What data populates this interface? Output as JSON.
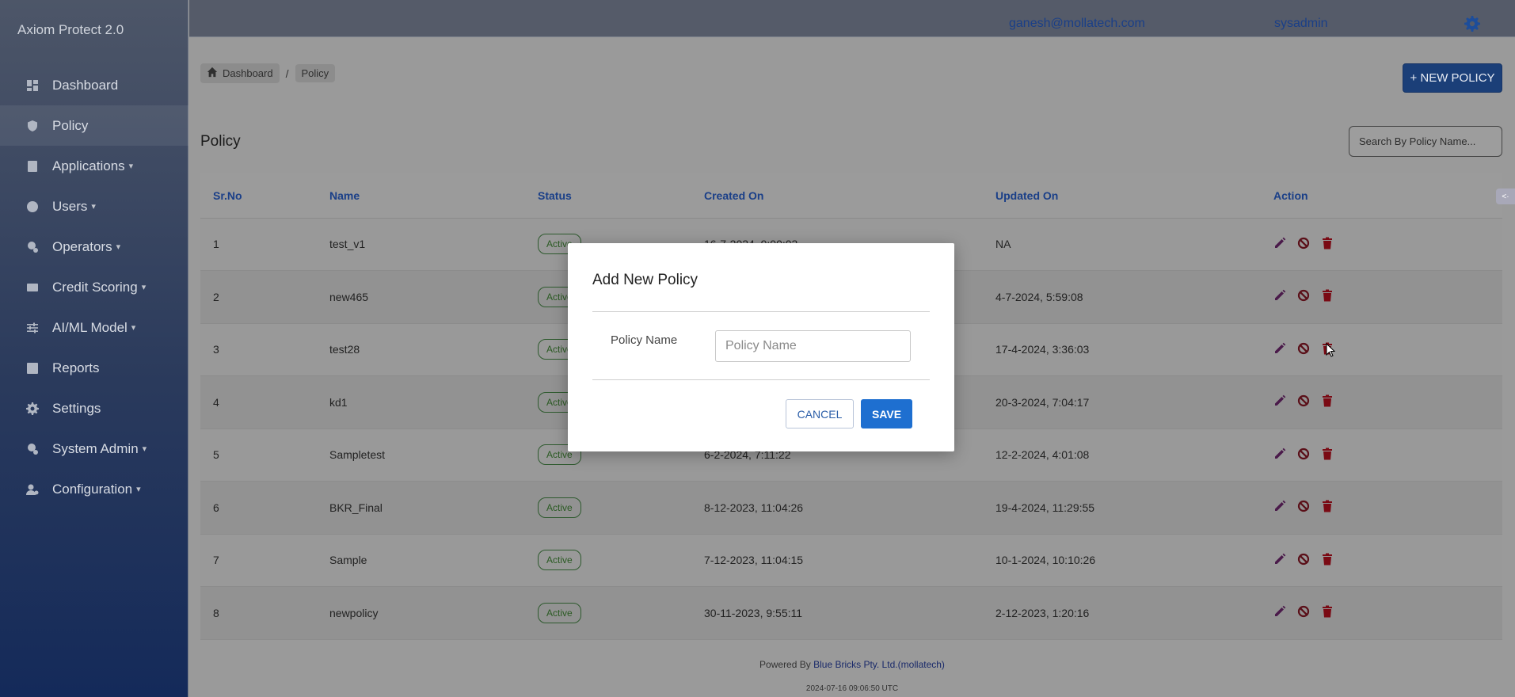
{
  "app": {
    "title": "Axiom Protect 2.0"
  },
  "sidebar": {
    "items": [
      {
        "label": "Dashboard",
        "icon": "dashboard-icon",
        "dropdown": false,
        "active": false
      },
      {
        "label": "Policy",
        "icon": "shield-icon",
        "dropdown": false,
        "active": true
      },
      {
        "label": "Applications",
        "icon": "applications-icon",
        "dropdown": true,
        "active": false
      },
      {
        "label": "Users",
        "icon": "user-icon",
        "dropdown": true,
        "active": false
      },
      {
        "label": "Operators",
        "icon": "operators-icon",
        "dropdown": true,
        "active": false
      },
      {
        "label": "Credit Scoring",
        "icon": "credit-card-icon",
        "dropdown": true,
        "active": false
      },
      {
        "label": "AI/ML Model",
        "icon": "sliders-icon",
        "dropdown": true,
        "active": false
      },
      {
        "label": "Reports",
        "icon": "chart-icon",
        "dropdown": false,
        "active": false
      },
      {
        "label": "Settings",
        "icon": "gear-icon",
        "dropdown": false,
        "active": false
      },
      {
        "label": "System Admin",
        "icon": "admin-icon",
        "dropdown": true,
        "active": false
      },
      {
        "label": "Configuration",
        "icon": "config-icon",
        "dropdown": true,
        "active": false
      }
    ]
  },
  "header": {
    "email": "ganesh@mollatech.com",
    "username": "sysadmin",
    "settings_icon": "gear-icon"
  },
  "breadcrumb": {
    "home": "Dashboard",
    "separator": "/",
    "current": "Policy"
  },
  "toolbar": {
    "new_policy_label": "+ NEW POLICY"
  },
  "page": {
    "title": "Policy"
  },
  "search": {
    "placeholder": "Search By Policy Name..."
  },
  "table": {
    "columns": [
      "Sr.No",
      "Name",
      "Status",
      "Created On",
      "Updated On",
      "Action"
    ],
    "rows": [
      {
        "sr": "1",
        "name": "test_v1",
        "status": "Active",
        "created": "16-7-2024, 9:00:03",
        "updated": "NA"
      },
      {
        "sr": "2",
        "name": "new465",
        "status": "Active",
        "created": "",
        "updated": "4-7-2024, 5:59:08"
      },
      {
        "sr": "3",
        "name": "test28",
        "status": "Active",
        "created": "",
        "updated": "17-4-2024, 3:36:03"
      },
      {
        "sr": "4",
        "name": "kd1",
        "status": "Active",
        "created": "",
        "updated": "20-3-2024, 7:04:17"
      },
      {
        "sr": "5",
        "name": "Sampletest",
        "status": "Active",
        "created": "6-2-2024, 7:11:22",
        "updated": "12-2-2024, 4:01:08"
      },
      {
        "sr": "6",
        "name": "BKR_Final",
        "status": "Active",
        "created": "8-12-2023, 11:04:26",
        "updated": "19-4-2024, 11:29:55"
      },
      {
        "sr": "7",
        "name": "Sample",
        "status": "Active",
        "created": "7-12-2023, 11:04:15",
        "updated": "10-1-2024, 10:10:26"
      },
      {
        "sr": "8",
        "name": "newpolicy",
        "status": "Active",
        "created": "30-11-2023, 9:55:11",
        "updated": "2-12-2023, 1:20:16"
      }
    ]
  },
  "footer": {
    "powered_by": "Powered By",
    "company": "Blue Bricks Pty. Ltd.(mollatech)",
    "timestamp": "2024-07-16 09:06:50 UTC"
  },
  "modal": {
    "title": "Add New Policy",
    "field_label": "Policy Name",
    "field_placeholder": "Policy Name",
    "field_value": "",
    "cancel_label": "CANCEL",
    "save_label": "SAVE"
  },
  "colors": {
    "accent": "#1e6fd0",
    "sidebar_bg": "#2a3a5c",
    "active_badge": "#2a5a22",
    "delete": "#7a0a14"
  }
}
